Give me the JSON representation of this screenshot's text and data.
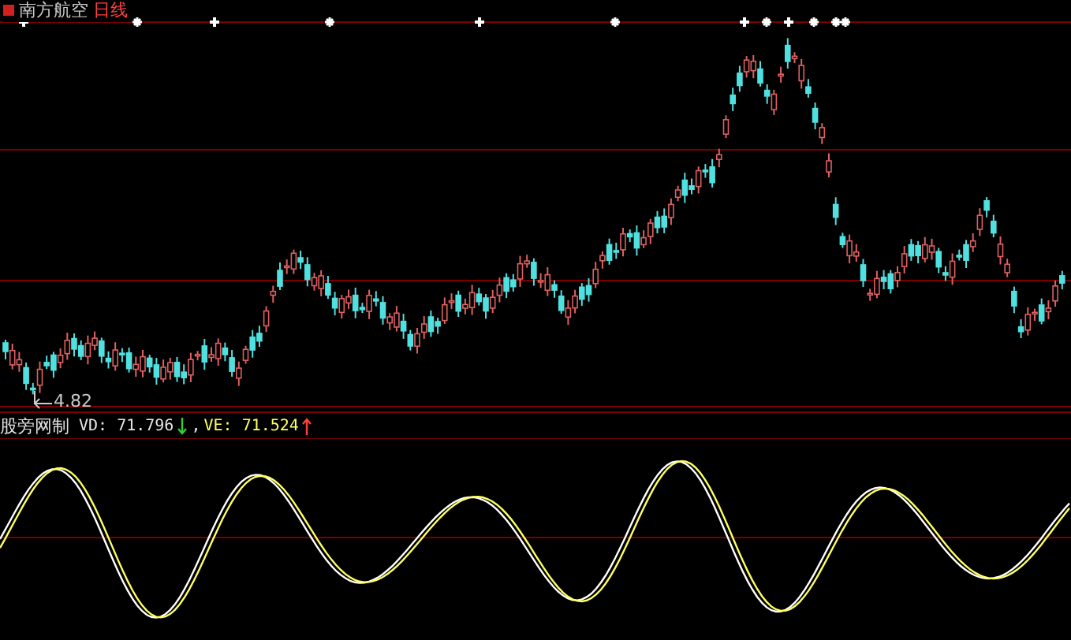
{
  "header": {
    "stock_name": "南方航空",
    "period": "日线"
  },
  "signal_markers": [
    {
      "kind": "plus"
    },
    {
      "kind": "star"
    },
    {
      "kind": "plus"
    },
    {
      "kind": "star"
    },
    {
      "kind": "plus"
    },
    {
      "kind": "star"
    },
    {
      "kind": "plus"
    },
    {
      "kind": "star"
    },
    {
      "kind": "plus"
    },
    {
      "kind": "star"
    },
    {
      "kind": "star"
    },
    {
      "kind": "star"
    }
  ],
  "low_price_label": "4.82",
  "indicator": {
    "name": "股旁网制",
    "values": [
      {
        "label": "VD:",
        "value": "71.796",
        "rising": false
      },
      {
        "separator": ",",
        "label": "VE:",
        "value": "71.524",
        "rising": true
      }
    ]
  }
}
